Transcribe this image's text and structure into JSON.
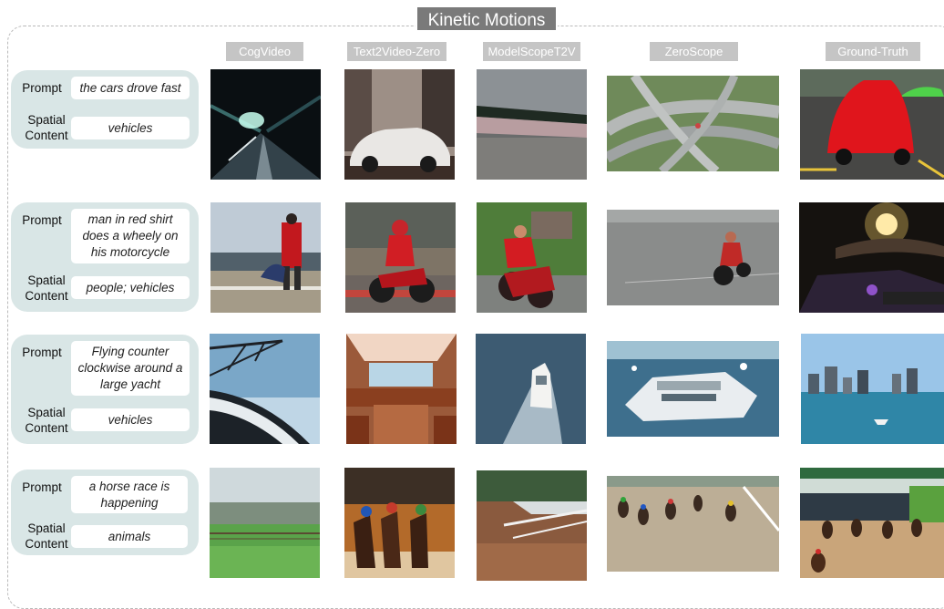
{
  "figure": {
    "title": "Kinetic Motions",
    "columns": [
      "CogVideo",
      "Text2Video-Zero",
      "ModelScopeT2V",
      "ZeroScope",
      "Ground-Truth"
    ],
    "prompt_label": "Prompt",
    "spatial_label_line1": "Spatial",
    "spatial_label_line2": "Content"
  },
  "rows": [
    {
      "prompt": "the cars drove fast",
      "spatial": "vehicles",
      "thumbs": [
        "motion-blurred highway tunnel",
        "white sports car on road",
        "asphalt road with curb",
        "aerial view of highway interchange",
        "red sports car in parking lot"
      ]
    },
    {
      "prompt": "man in red shirt does a wheely on his motorcycle",
      "spatial": "people; vehicles",
      "thumbs": [
        "man in red on railing",
        "red motorcycle rider",
        "man in red on red motorcycle",
        "man on motorcycle doing wheelie",
        "night motorcycle ride with lights"
      ]
    },
    {
      "prompt": "Flying counter clockwise around a large yacht",
      "spatial": "vehicles",
      "thumbs": [
        "boat hull under bridge",
        "yacht interior cabin",
        "white yacht on water",
        "large yacht aerial view",
        "city skyline with boat"
      ]
    },
    {
      "prompt": "a horse race is happening",
      "spatial": "animals",
      "thumbs": [
        "green field with fence",
        "racing horses and jockeys",
        "race track with fence",
        "horses racing on dirt track",
        "horse race starting gate"
      ]
    }
  ],
  "colors": {
    "panel": "#d9e6e6",
    "header": "#c5c5c5",
    "title_bg": "#7a7a7a"
  }
}
